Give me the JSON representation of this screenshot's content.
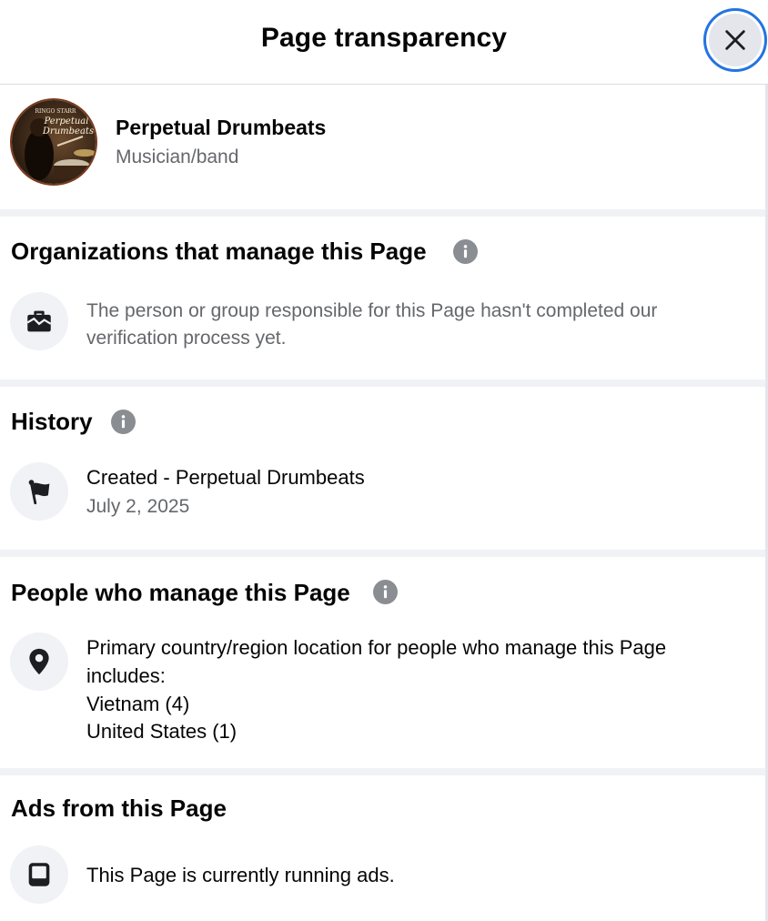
{
  "header": {
    "title": "Page transparency"
  },
  "profile": {
    "avatar_lines": [
      "RINGO STARR",
      "Perpetual",
      "Drumbeats"
    ],
    "name": "Perpetual Drumbeats",
    "category": "Musician/band"
  },
  "organizations": {
    "title": "Organizations that manage this Page",
    "text": "The person or group responsible for this Page hasn't completed our verification process yet."
  },
  "history": {
    "title": "History",
    "entry_title": "Created - Perpetual Drumbeats",
    "entry_date": "July 2, 2025"
  },
  "people": {
    "title": "People who manage this Page",
    "intro_line1": "Primary country/region location for people who manage this Page",
    "intro_line2": "includes:",
    "locations": [
      "Vietnam (4)",
      "United States (1)"
    ]
  },
  "ads": {
    "title": "Ads from this Page",
    "text": "This Page is currently running ads."
  },
  "colors": {
    "accent": "#2374e1",
    "section_gap": "#f0f2f5",
    "muted_text": "#65676b",
    "icon_bg": "#f0f2f5"
  },
  "icons": {
    "close": "close-icon",
    "info": "info-icon",
    "organization": "briefcase-icon",
    "history": "flag-icon",
    "location": "location-pin-icon",
    "ads": "ads-device-icon"
  }
}
